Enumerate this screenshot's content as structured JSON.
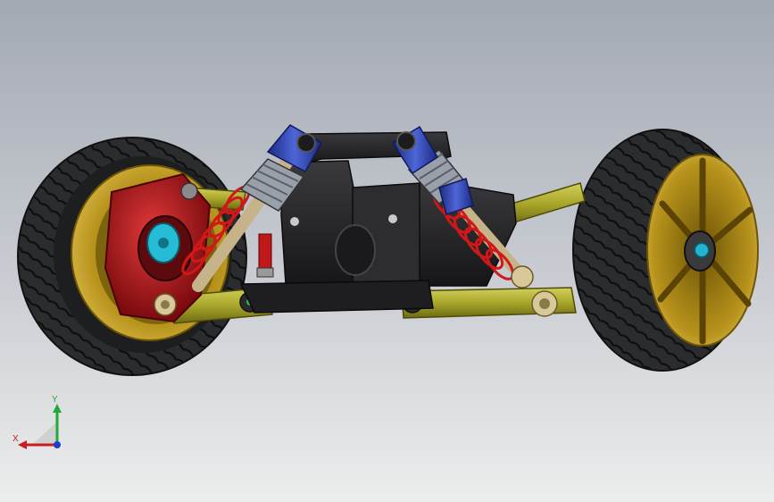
{
  "viewport": {
    "colors": {
      "bg_top": "#a3a9b3",
      "bg_bottom": "#eceded",
      "tire": "#2b2c2e",
      "rim": "#b8941c",
      "arm": "#a8a62a",
      "hub": "#b0121a",
      "shock_body": "#2a3fa8",
      "spring": "#d01818",
      "chassis": "#262629"
    },
    "triad": {
      "x_label": "X",
      "y_label": "Y",
      "x_color": "#c81e1e",
      "y_color": "#22a838",
      "z_color": "#1e3ccc"
    }
  }
}
